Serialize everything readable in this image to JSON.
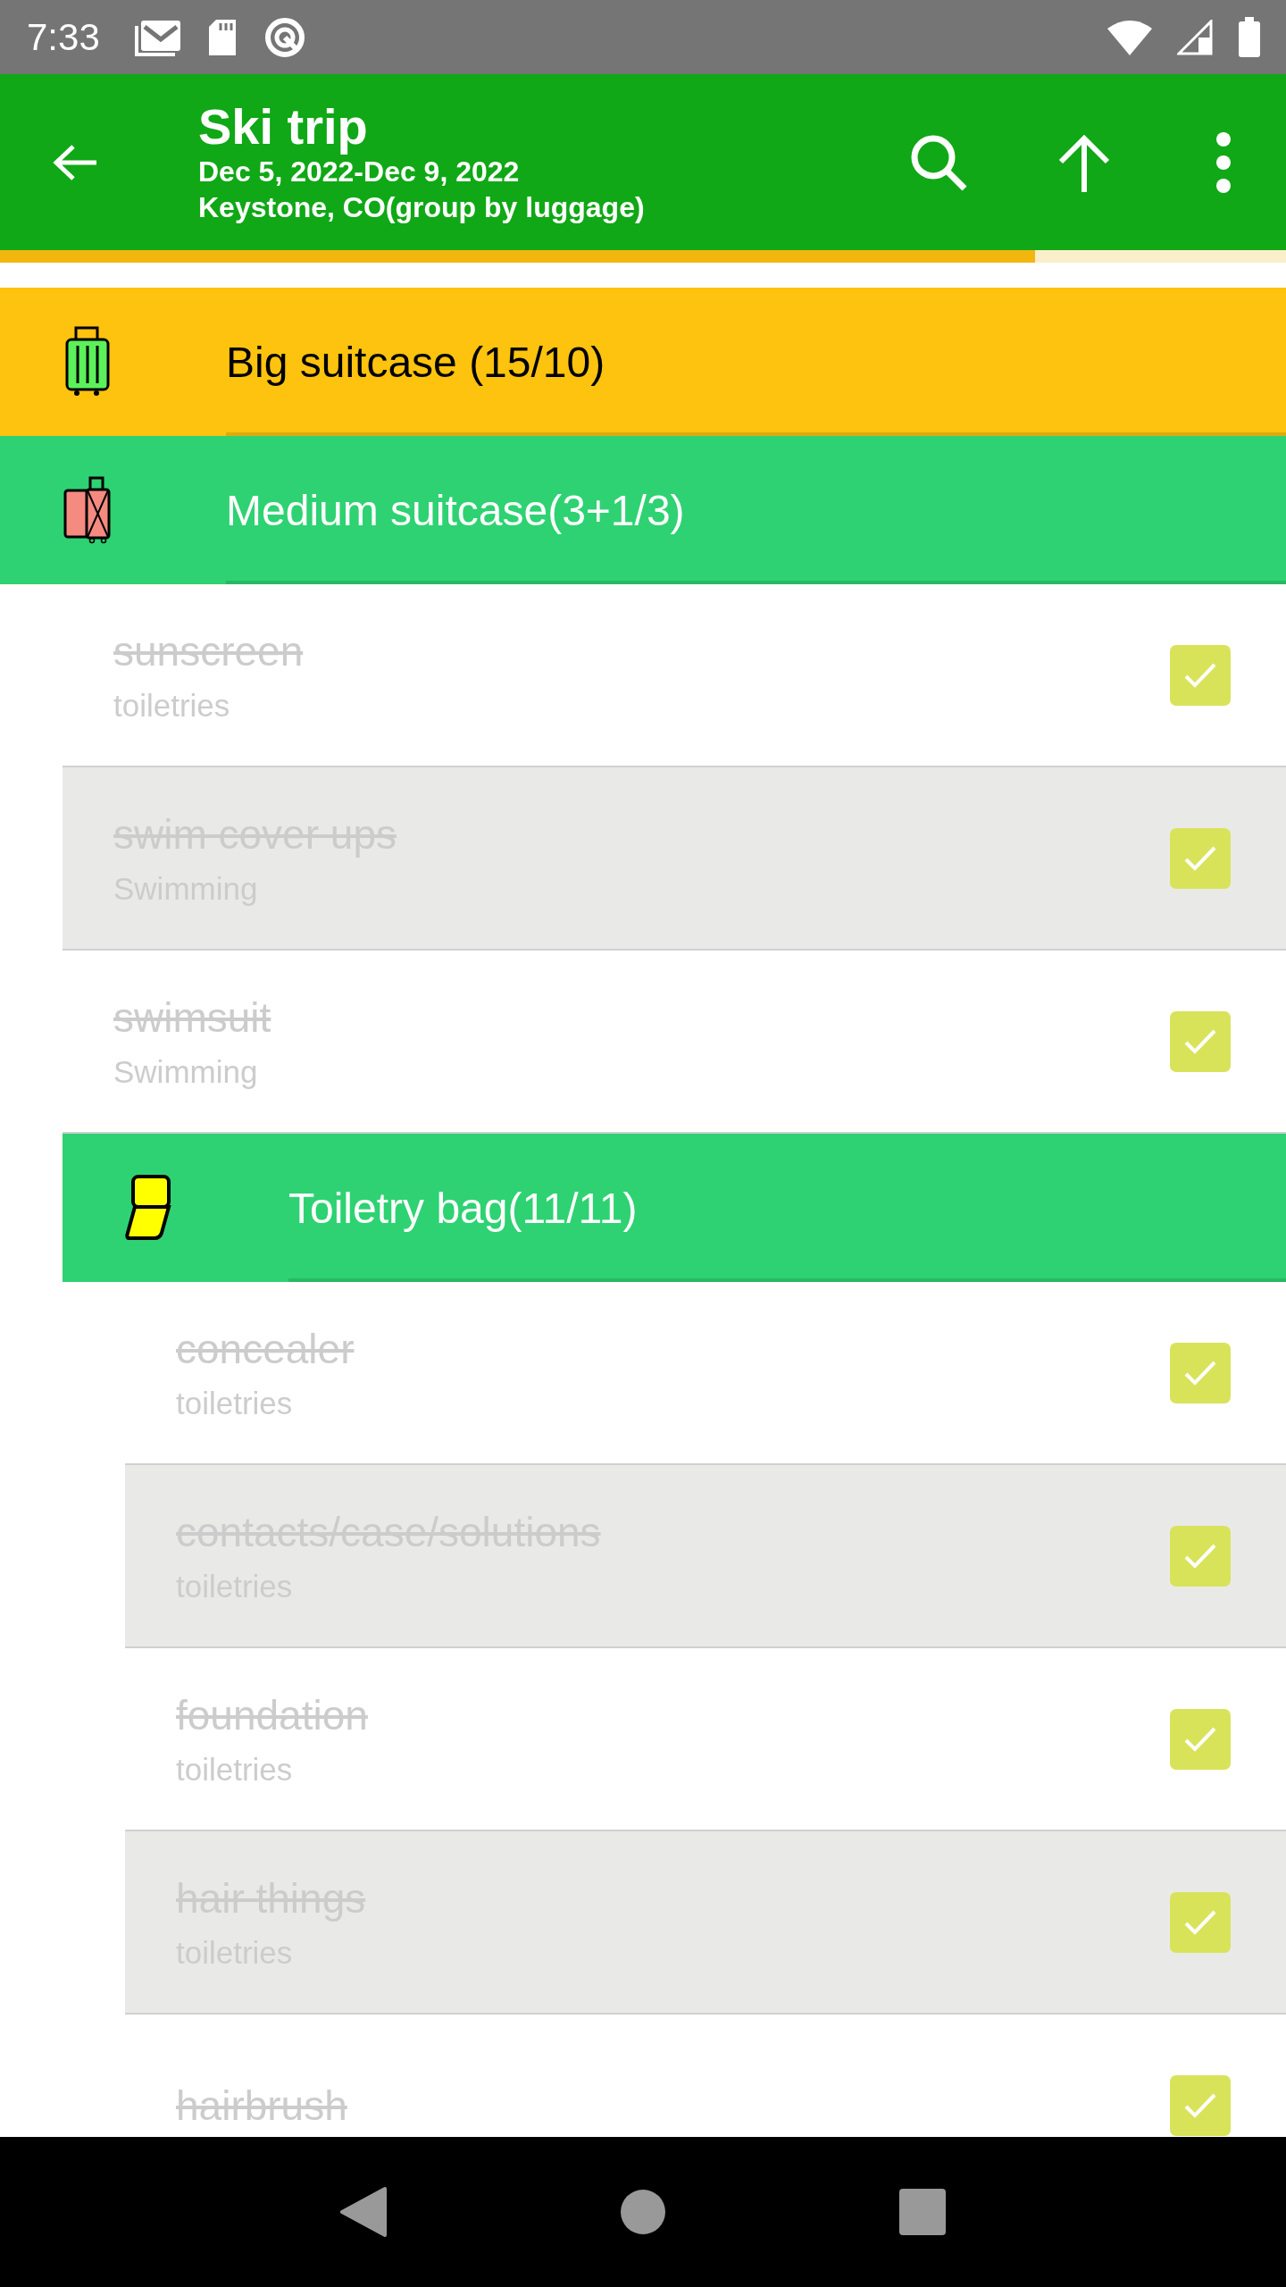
{
  "status_bar": {
    "time": "7:33"
  },
  "app_bar": {
    "title": "Ski trip",
    "subtitle_lines": [
      "Dec 5, 2022-Dec 9, 2022",
      "Keystone, CO(group by luggage)"
    ]
  },
  "progress": {
    "level": 0.805
  },
  "groups": [
    {
      "title": "Big suitcase (15/10)",
      "color": "#fdc30e"
    },
    {
      "title": "Medium suitcase(3+1/3)",
      "color": "#2ed272",
      "items": [
        {
          "name": "sunscreen",
          "category": "toiletries",
          "checked": true
        },
        {
          "name": "swim cover ups",
          "category": "Swimming",
          "checked": true
        },
        {
          "name": "swimsuit",
          "category": "Swimming",
          "checked": true
        }
      ],
      "children": [
        {
          "title": "Toiletry bag(11/11)",
          "color": "#2ed272",
          "items": [
            {
              "name": "concealer",
              "category": "toiletries",
              "checked": true
            },
            {
              "name": "contacts/case/solutions",
              "category": "toiletries",
              "checked": true
            },
            {
              "name": "foundation",
              "category": "toiletries",
              "checked": true
            },
            {
              "name": "hair things",
              "category": "toiletries",
              "checked": true
            },
            {
              "name": "hairbrush",
              "checked": true
            }
          ]
        }
      ]
    }
  ]
}
